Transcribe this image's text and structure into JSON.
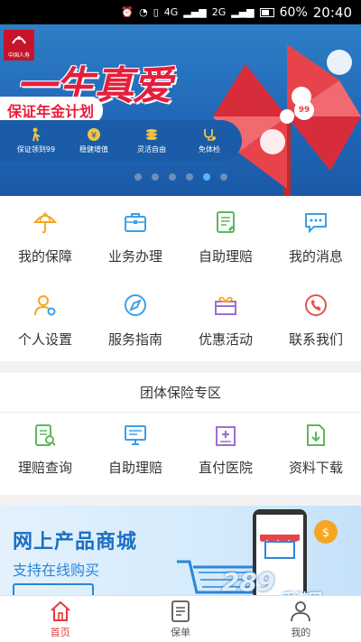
{
  "status_bar": {
    "carrier1": "4G",
    "carrier2": "2G",
    "battery_pct": "60%",
    "time": "20:40"
  },
  "banner": {
    "logo_text": "中国人寿",
    "headline": "一生真爱",
    "subtitle": "保证年金计划",
    "badge": "99",
    "features": [
      {
        "icon": "elder-icon",
        "label": "保证领到99"
      },
      {
        "icon": "yuan-coin-icon",
        "label": "稳健增值"
      },
      {
        "icon": "coins-stack-icon",
        "label": "灵活自由"
      },
      {
        "icon": "stethoscope-icon",
        "label": "免体检"
      }
    ],
    "slides_total": 6,
    "active_slide": 4
  },
  "menu": {
    "items": [
      {
        "label": "我的保障",
        "icon": "umbrella-icon",
        "color": "#f5a623"
      },
      {
        "label": "业务办理",
        "icon": "briefcase-icon",
        "color": "#3aa0e8"
      },
      {
        "label": "自助理赔",
        "icon": "claim-form-icon",
        "color": "#5cb85c"
      },
      {
        "label": "我的消息",
        "icon": "message-icon",
        "color": "#3aa0e8"
      },
      {
        "label": "个人设置",
        "icon": "user-settings-icon",
        "color": "#f5a623"
      },
      {
        "label": "服务指南",
        "icon": "compass-icon",
        "color": "#3aa0e8"
      },
      {
        "label": "优惠活动",
        "icon": "gift-icon",
        "color": "#9b6fd3"
      },
      {
        "label": "联系我们",
        "icon": "phone-icon",
        "color": "#e6544a"
      }
    ]
  },
  "group": {
    "title": "团体保险专区",
    "items": [
      {
        "label": "理赔查询",
        "icon": "claim-search-icon",
        "color": "#5cb85c"
      },
      {
        "label": "自助理赔",
        "icon": "monitor-icon",
        "color": "#3aa0e8"
      },
      {
        "label": "直付医院",
        "icon": "hospital-icon",
        "color": "#9b6fd3"
      },
      {
        "label": "资料下载",
        "icon": "download-doc-icon",
        "color": "#5cb85c"
      }
    ]
  },
  "promo": {
    "title": "网上产品商城",
    "subtitle": "支持在线购买"
  },
  "tabbar": {
    "items": [
      {
        "label": "首页",
        "icon": "home-icon",
        "active": true
      },
      {
        "label": "保单",
        "icon": "policy-icon",
        "active": false
      },
      {
        "label": "我的",
        "icon": "profile-icon",
        "active": false
      }
    ]
  },
  "watermark": {
    "brand": "289",
    "sub": "手游网"
  },
  "colors": {
    "accent": "#e63a3a",
    "banner_blue": "#1f66b6",
    "headline_red": "#e61e3c"
  }
}
